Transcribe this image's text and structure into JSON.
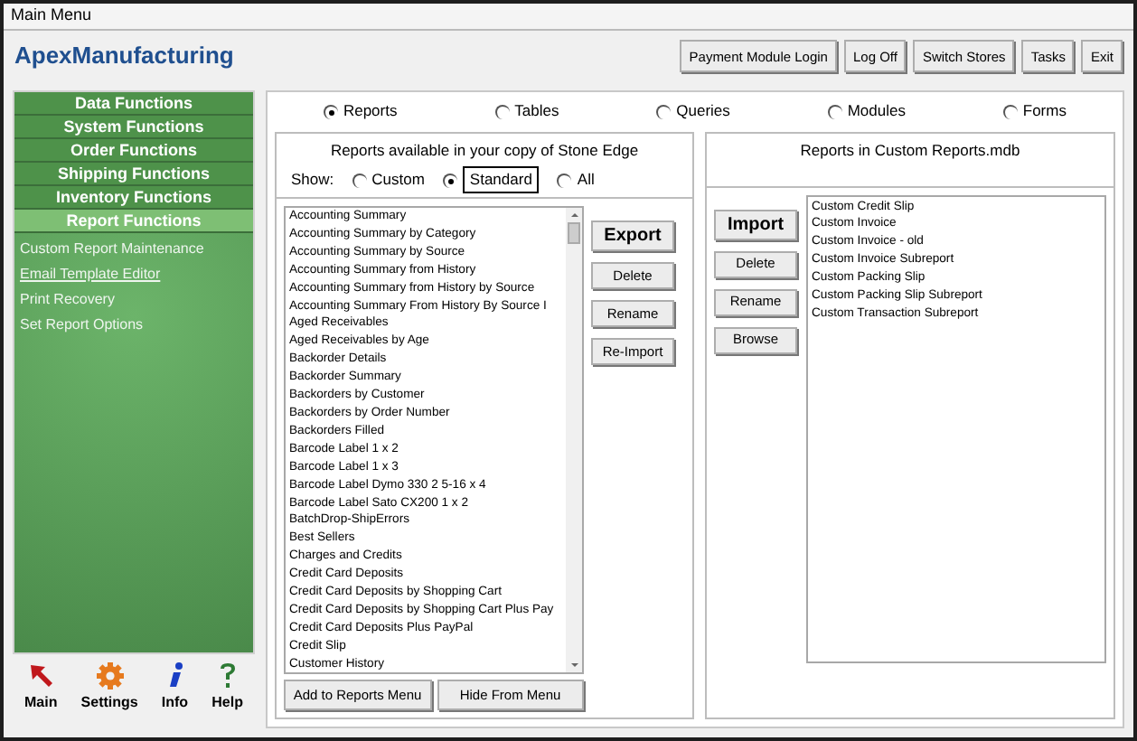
{
  "window": {
    "title": "Main Menu"
  },
  "app_title": "ApexManufacturing",
  "header_buttons": [
    "Payment Module Login",
    "Log Off",
    "Switch Stores",
    "Tasks",
    "Exit"
  ],
  "sidebar": {
    "sections": [
      {
        "label": "Data Functions",
        "selected": false
      },
      {
        "label": "System Functions",
        "selected": false
      },
      {
        "label": "Order Functions",
        "selected": false
      },
      {
        "label": "Shipping Functions",
        "selected": false
      },
      {
        "label": "Inventory Functions",
        "selected": false
      },
      {
        "label": "Report Functions",
        "selected": true
      }
    ],
    "items": [
      {
        "label": "Custom Report Maintenance",
        "hovered": false
      },
      {
        "label": "Email Template Editor",
        "hovered": true
      },
      {
        "label": "Print Recovery",
        "hovered": false
      },
      {
        "label": "Set Report Options",
        "hovered": false
      }
    ]
  },
  "bottom_icons": [
    {
      "kind": "main",
      "label": "Main"
    },
    {
      "kind": "settings",
      "label": "Settings"
    },
    {
      "kind": "info",
      "label": "Info"
    },
    {
      "kind": "help",
      "label": "Help"
    }
  ],
  "object_types": [
    {
      "label": "Reports",
      "selected": true
    },
    {
      "label": "Tables",
      "selected": false
    },
    {
      "label": "Queries",
      "selected": false
    },
    {
      "label": "Modules",
      "selected": false
    },
    {
      "label": "Forms",
      "selected": false
    }
  ],
  "left_panel": {
    "title": "Reports available in your copy of Stone Edge",
    "show_label": "Show:",
    "show_options": [
      {
        "label": "Custom",
        "selected": false
      },
      {
        "label": "Standard",
        "selected": true
      },
      {
        "label": "All",
        "selected": false
      }
    ],
    "reports": [
      "Accounting Summary",
      "Accounting Summary by Category",
      "Accounting Summary by Source",
      "Accounting Summary from History",
      "Accounting Summary from History by Source",
      "Accounting Summary From History By Source I",
      "Aged Receivables",
      "Aged Receivables by Age",
      "Backorder Details",
      "Backorder Summary",
      "Backorders by Customer",
      "Backorders by Order Number",
      "Backorders Filled",
      "Barcode Label 1 x 2",
      "Barcode Label 1 x 3",
      "Barcode Label Dymo 330 2 5-16 x 4",
      "Barcode Label Sato CX200 1 x 2",
      "BatchDrop-ShipErrors",
      "Best Sellers",
      "Charges and Credits",
      "Credit Card Deposits",
      "Credit Card Deposits by Shopping Cart",
      "Credit Card Deposits by Shopping Cart Plus Pay",
      "Credit Card Deposits Plus PayPal",
      "Credit Slip",
      "Customer History"
    ],
    "primary_button": "Export",
    "buttons": [
      "Delete",
      "Rename",
      "Re-Import"
    ],
    "bottom_buttons": [
      "Add to Reports Menu",
      "Hide From Menu"
    ]
  },
  "right_panel": {
    "title": "Reports in Custom Reports.mdb",
    "primary_button": "Import",
    "buttons": [
      "Delete",
      "Rename",
      "Browse"
    ],
    "reports": [
      "Custom Credit Slip",
      "Custom Invoice",
      "Custom Invoice - old",
      "Custom Invoice Subreport",
      "Custom Packing Slip",
      "Custom Packing Slip Subreport",
      "Custom Transaction Subreport"
    ]
  }
}
